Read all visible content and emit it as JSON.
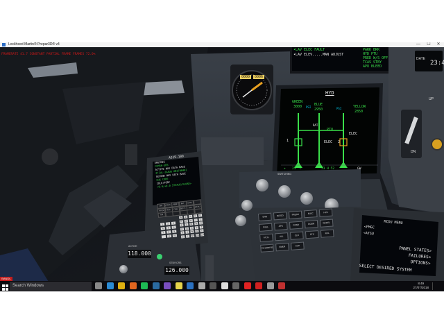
{
  "window": {
    "title": "Lockheed Martin® Prepar3D® v4",
    "controls": {
      "minimize": "—",
      "maximize": "☐",
      "close": "✕"
    }
  },
  "debug_text": "FRAMERATE 41.7  CONSTANT PARTIAL FRAME  FRAMES 72.0%",
  "overhead_panel": {
    "line1": "•LAV ELEC FAULT",
    "line2": "•LAV ELEV.....MAN ADJUST",
    "memo": [
      "PARK BRK",
      "HYD PTU",
      "PRED W/S OFF",
      "TCAS STBY",
      "APU BLEED"
    ]
  },
  "clock_panel": {
    "date_label": "DATE",
    "time": "23:4"
  },
  "altimeter": {
    "left": "0000",
    "right": "0006"
  },
  "ecam_hyd": {
    "title": "HYD",
    "systems": [
      {
        "name": "GREEN",
        "pressure": "3000",
        "color": "#3adf4a"
      },
      {
        "name": "BLUE",
        "pressure": "2950",
        "color": "#3adf4a"
      },
      {
        "name": "YELLOW",
        "pressure": "2850",
        "color": "#3adf4a"
      }
    ],
    "labels": {
      "ptu": "PTU",
      "elec": "ELEC",
      "elec2": "ELEC",
      "rat": "RAT",
      "psi": "PSI",
      "psi2": "PSI",
      "num1": "1",
      "num2": "2"
    },
    "footer": {
      "tat": "+",
      "value": "23 °C",
      "time": "23 H 52",
      "gw": "GW"
    }
  },
  "mcdu_left": {
    "title": "A319-100",
    "lines": [
      "ENGINES",
      "CFM56-5B5",
      "ACTIVE NAV DATA BASE",
      "27JUL-24AUG AB1708402",
      "SECOND NAV DATA BASE",
      "CHG CODE",
      "IDLE/PERF",
      "+0.0/+0.0 STATUS/XLOAD>"
    ],
    "keys": [
      "DIR",
      "PROG",
      "PERF",
      "INIT",
      "DATA",
      "",
      "F-PLN",
      "RAD NAV",
      "FUEL PRED",
      "SEC F-PLN",
      "ATC COMM",
      "MCDU MENU",
      "AIR PORT",
      "",
      "",
      "",
      "",
      ""
    ],
    "letters": [
      "A",
      "B",
      "C",
      "D",
      "E",
      "F",
      "G",
      "H",
      "I",
      "J",
      "K",
      "L",
      "M",
      "N",
      "O",
      "P",
      "Q",
      "R",
      "S",
      "T",
      "U",
      "V",
      "W",
      "X",
      "Y",
      "Z",
      "/",
      "SP",
      "OVFY",
      "CLR"
    ],
    "digits": [
      "1",
      "2",
      "3",
      "4",
      "5",
      "6",
      "7",
      "8",
      "9",
      ".",
      "0",
      "+/-"
    ]
  },
  "radio_panel": {
    "active": "118.000",
    "standby": "126.000",
    "active_label": "ACTIVE",
    "standby_label": "STBY/CRS"
  },
  "switching_panel": {
    "title": "SWITCHING",
    "knobs": [
      "ATT HDG",
      "AIR DATA",
      "EIS DMC",
      "ECAM/ND XFR"
    ]
  },
  "ecam_control": {
    "buttons": [
      "ENG",
      "BLEED",
      "PRESS",
      "ELEC",
      "HYD",
      "FUEL",
      "APU",
      "COND",
      "DOOR",
      "WHEEL",
      "F/CTL",
      "ALL",
      "CLR",
      "STS",
      "RCL",
      "TO CONFIG",
      "EMER CANC",
      "CLR"
    ]
  },
  "mcdu_right": {
    "title": "MCDU MENU",
    "lines": [
      "<FMGC",
      "<ATSU",
      "PANEL STATES>",
      "FAILURES>",
      "OPTIONS>",
      "SELECT DESIRED SYSTEM"
    ]
  },
  "side_panel": {
    "up_label": "UP",
    "dn_label": "DN"
  },
  "taskbar": {
    "search_placeholder": "Search Windows",
    "time": "8:49",
    "date": "27/07/2018",
    "recording_badge": "BANDI-REC",
    "icons": [
      {
        "name": "task-view-icon",
        "color": "#888888"
      },
      {
        "name": "edge-icon",
        "color": "#2a8ad4"
      },
      {
        "name": "chrome-icon",
        "color": "#e0b010"
      },
      {
        "name": "firefox-icon",
        "color": "#e2661f"
      },
      {
        "name": "spotify-icon",
        "color": "#1db954"
      },
      {
        "name": "steam-icon",
        "color": "#2a6aa0"
      },
      {
        "name": "vs-icon",
        "color": "#7a4ec0"
      },
      {
        "name": "notes-icon",
        "color": "#e6d34a"
      },
      {
        "name": "mail-icon",
        "color": "#2a70c0"
      },
      {
        "name": "globe-icon",
        "color": "#aaaaaa"
      },
      {
        "name": "terminal-icon",
        "color": "#555555"
      },
      {
        "name": "plane-icon",
        "color": "#dddddd"
      },
      {
        "name": "calc-icon",
        "color": "#666666"
      },
      {
        "name": "youtube-icon",
        "color": "#e02222"
      },
      {
        "name": "record-icon",
        "color": "#d02020"
      },
      {
        "name": "disc-icon",
        "color": "#9a9a9a"
      },
      {
        "name": "app-icon",
        "color": "#c03030"
      }
    ]
  }
}
